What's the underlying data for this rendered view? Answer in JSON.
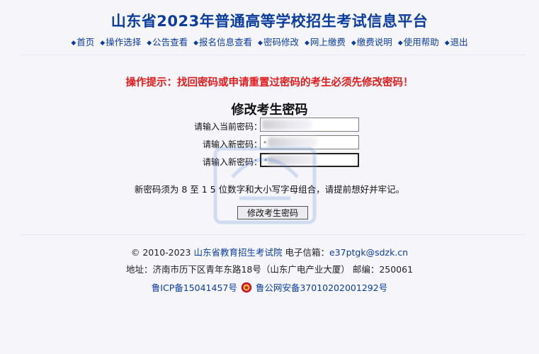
{
  "header": {
    "title": "山东省2023年普通高等学校招生考试信息平台",
    "nav": [
      {
        "label": "首页"
      },
      {
        "label": "操作选择"
      },
      {
        "label": "公告查看"
      },
      {
        "label": "报名信息查看"
      },
      {
        "label": "密码修改"
      },
      {
        "label": "网上缴费"
      },
      {
        "label": "缴费说明"
      },
      {
        "label": "使用帮助"
      },
      {
        "label": "退出"
      }
    ]
  },
  "notice": "操作提示：找回密码或申请重置过密码的考生必须先修改密码！",
  "form": {
    "title": "修改考生密码",
    "fields": [
      {
        "label": "请输入当前密码：",
        "value": ""
      },
      {
        "label": "请输入新密码：",
        "value": "•"
      },
      {
        "label": "请输入新密码：",
        "value": "•"
      }
    ],
    "rule_text": "新密码须为 8 至 1 5 位数字和大小写字母组合，请提前想好并牢记。",
    "submit_label": "修改考生密码"
  },
  "footer": {
    "copyright": "© 2010-2023",
    "org": "山东省教育招生考试院",
    "email_label": "电子信箱：",
    "email": "e37ptgk@sdzk.cn",
    "address": "地址：济南市历下区青年东路18号（山东广电产业大厦） 邮编：250061",
    "icp": "鲁ICP备15041457号",
    "police": "鲁公网安备37010202001292号"
  },
  "colors": {
    "title": "#0b3d9e",
    "notice": "#e21b1b",
    "link": "#0b3d9e",
    "background": "#f5f5fa"
  },
  "icons": {
    "nav_bullet": "diamond-bullet-icon",
    "police": "police-badge-icon"
  }
}
